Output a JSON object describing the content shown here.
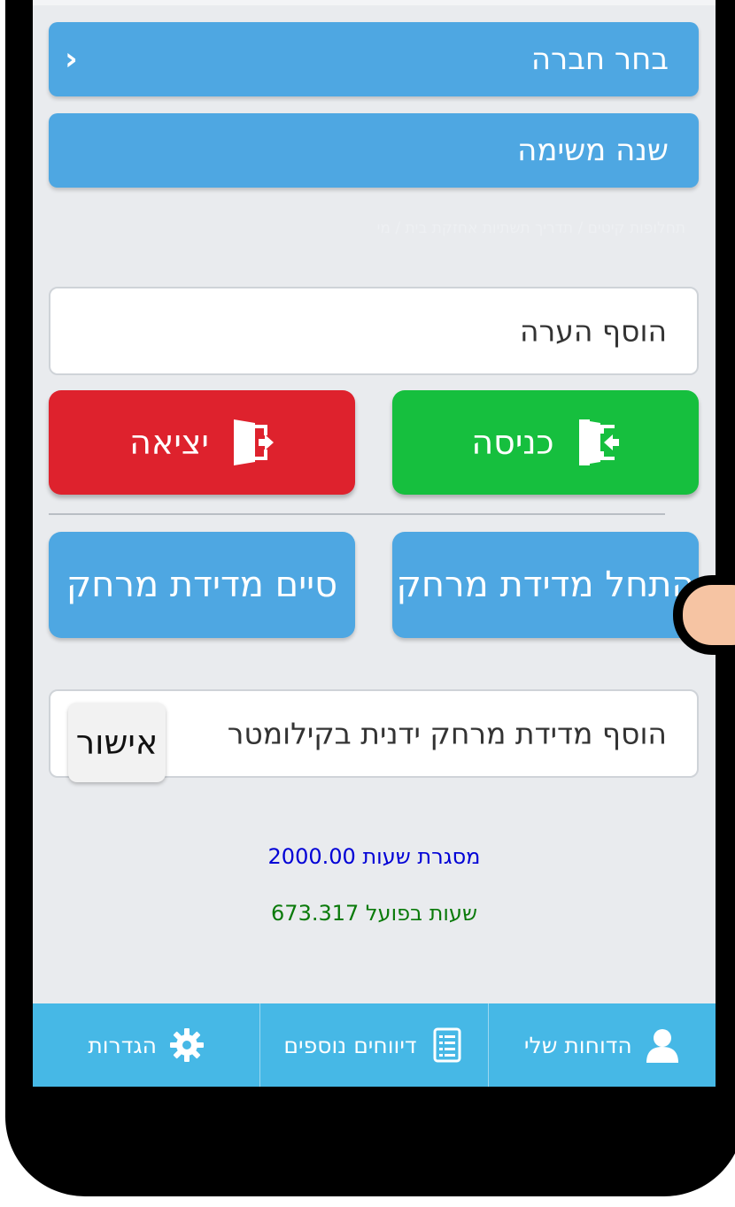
{
  "header": {
    "choose_company": "בחר חברה",
    "change_task": "שנה משימה",
    "faint_note": "תחלופות קיטים / תדריך תשתיות אחזקת בית / מי"
  },
  "note_input": {
    "placeholder": "הוסף הערה"
  },
  "actions": {
    "enter_label": "כניסה",
    "exit_label": "יציאה"
  },
  "distance": {
    "start_label": "התחל מדידת מרחק",
    "end_label": "סיים מדידת מרחק",
    "manual_placeholder": "הוסף מדידת מרחק ידנית בקילומטר",
    "confirm_label": "אישור"
  },
  "stats": {
    "hours_frame": "מסגרת שעות 2000.00",
    "hours_actual": "שעות בפועל 673.317",
    "frame_color": "#0000d6",
    "actual_color": "#0a7a0a"
  },
  "bottom_nav": {
    "items": [
      {
        "label": "הדוחות שלי",
        "icon": "user-icon"
      },
      {
        "label": "דיווחים נוספים",
        "icon": "list-icon"
      },
      {
        "label": "הגדרות",
        "icon": "gear-icon"
      }
    ]
  },
  "colors": {
    "primary_blue": "#4ea7e2",
    "enter_green": "#16bf3e",
    "exit_red": "#de222d",
    "nav_blue": "#46b8e6"
  }
}
